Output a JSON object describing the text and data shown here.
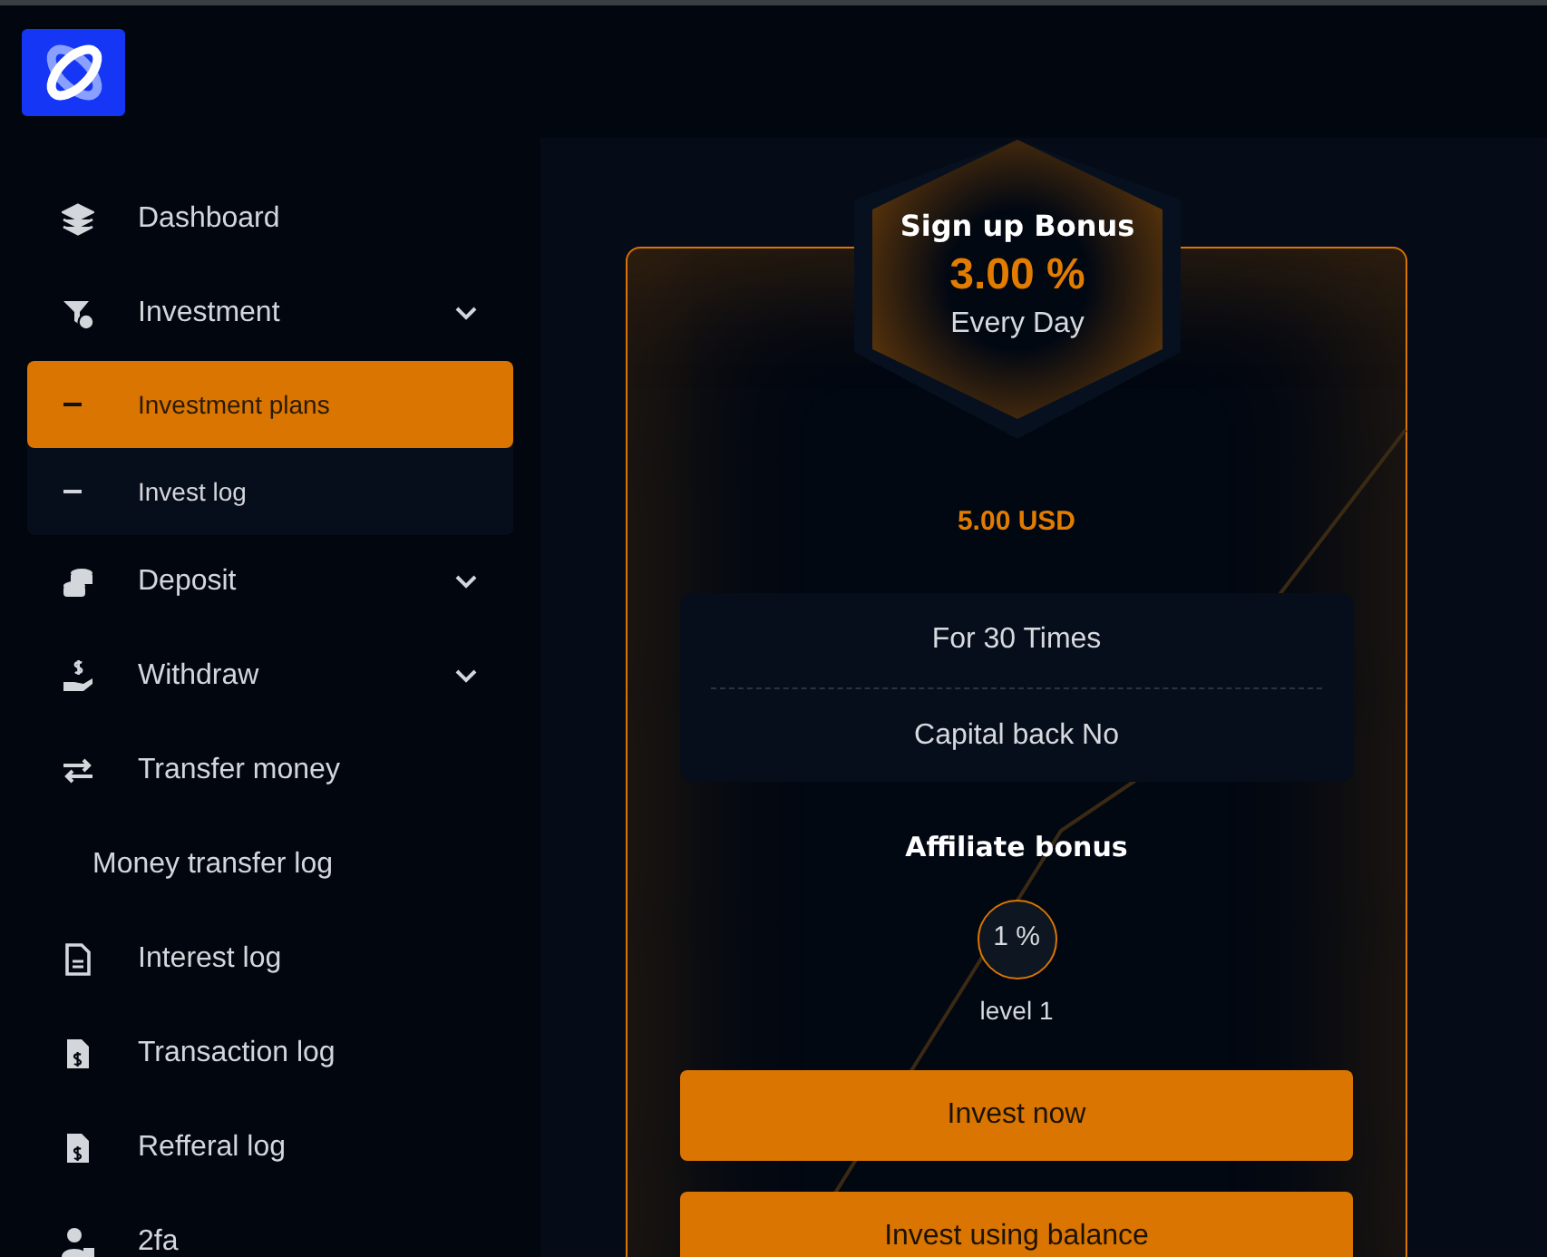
{
  "sidebar": {
    "items": [
      {
        "kind": "link",
        "label": "Dashboard"
      },
      {
        "kind": "dropdown",
        "label": "Investment",
        "children": [
          {
            "label": "Investment plans",
            "selected": true
          },
          {
            "label": "Invest log",
            "selected": false
          }
        ]
      },
      {
        "kind": "dropdown",
        "label": "Deposit"
      },
      {
        "kind": "dropdown",
        "label": "Withdraw"
      },
      {
        "kind": "link",
        "label": "Transfer money"
      },
      {
        "kind": "link",
        "label": "Money transfer log"
      },
      {
        "kind": "link",
        "label": "Interest log"
      },
      {
        "kind": "link",
        "label": "Transaction log"
      },
      {
        "kind": "link",
        "label": "Refferal log"
      },
      {
        "kind": "link",
        "label": "2fa"
      }
    ]
  },
  "plan": {
    "badge": {
      "title": "Sign up Bonus",
      "rate": "3.00 %",
      "period": "Every Day"
    },
    "price": "5.00 USD",
    "details": [
      "For 30 Times",
      "Capital back No"
    ],
    "affiliate": {
      "title": "Affiliate bonus",
      "levels": [
        {
          "percent": "1 %",
          "label": "level 1"
        }
      ]
    },
    "buttons": [
      "Invest now",
      "Invest using balance"
    ]
  }
}
